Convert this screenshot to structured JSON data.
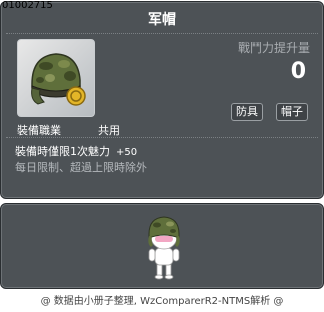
{
  "item": {
    "id": "01002715",
    "name": "军帽",
    "attack_label": "戰鬥力提升量",
    "attack_value": "0",
    "tags": [
      "防具",
      "帽子"
    ],
    "job_label": "裝備職業",
    "job_value": "共用",
    "effect_text": "裝備時僅限1次魅力",
    "effect_bonus": "+50",
    "limit_text": "每日限制、超過上限時除外",
    "icon": "army-helmet-icon"
  },
  "footer": {
    "text": "@ 数据由小册子整理, WzComparerR2-NTMS解析 @"
  },
  "colors": {
    "panel_bg": "#4d5256",
    "panel_border": "#2a2e31",
    "title_color": "#ffffff",
    "sub_text": "#a9adb1"
  }
}
